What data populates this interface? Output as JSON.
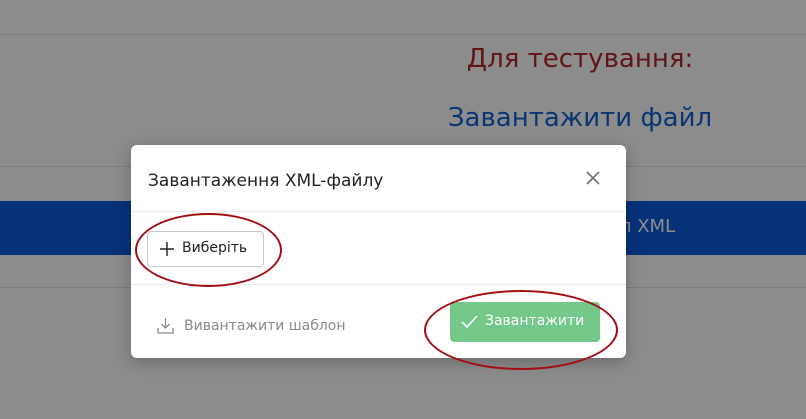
{
  "background": {
    "testing_title": "Для тестування:",
    "upload_link": "Завантажити файл",
    "blue_bar_label": "л XML"
  },
  "modal": {
    "title": "Завантаження XML-файлу",
    "select_button_label": "Виберіть",
    "download_template_label": "Вивантажити шаблон",
    "upload_button_label": "Завантажити"
  },
  "icons": {
    "close": "close-icon",
    "plus": "plus-icon",
    "download": "download-icon",
    "check": "check-icon"
  },
  "colors": {
    "testing_title": "#b3262a",
    "link": "#1262d3",
    "blue_bar": "#0d5bdd",
    "upload_button": "#74c98a",
    "annotation": "#a20e12"
  }
}
